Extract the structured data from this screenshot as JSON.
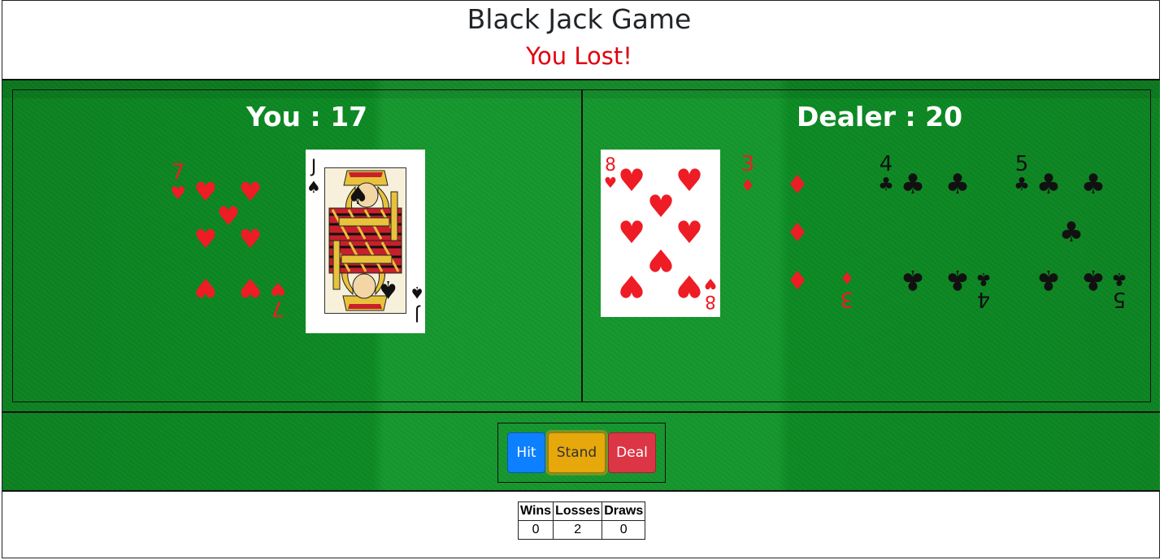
{
  "header": {
    "title": "Black Jack Game",
    "result": "You Lost!"
  },
  "player": {
    "label": "You : 17",
    "cards": [
      {
        "rank": "7",
        "suit": "hearts",
        "color": "#ee1c24"
      },
      {
        "rank": "J",
        "suit": "spades",
        "color": "#111111"
      }
    ]
  },
  "dealer": {
    "label": "Dealer : 20",
    "cards": [
      {
        "rank": "8",
        "suit": "hearts",
        "color": "#ee1c24"
      },
      {
        "rank": "3",
        "suit": "diamonds",
        "color": "#ee1c24"
      },
      {
        "rank": "4",
        "suit": "clubs",
        "color": "#111111"
      },
      {
        "rank": "5",
        "suit": "clubs",
        "color": "#111111"
      }
    ]
  },
  "controls": {
    "hit_label": "Hit",
    "stand_label": "Stand",
    "deal_label": "Deal"
  },
  "stats": {
    "headers": [
      "Wins",
      "Losses",
      "Draws"
    ],
    "values": [
      "0",
      "2",
      "0"
    ]
  },
  "colors": {
    "felt": "#0a8a22",
    "result": "#e0000f",
    "hit": "#0d80ff",
    "stand": "#e6a80a",
    "deal": "#dc3545"
  },
  "icons": {
    "hearts": "heart-icon",
    "spades": "spade-icon",
    "diamonds": "diamond-icon",
    "clubs": "club-icon"
  }
}
